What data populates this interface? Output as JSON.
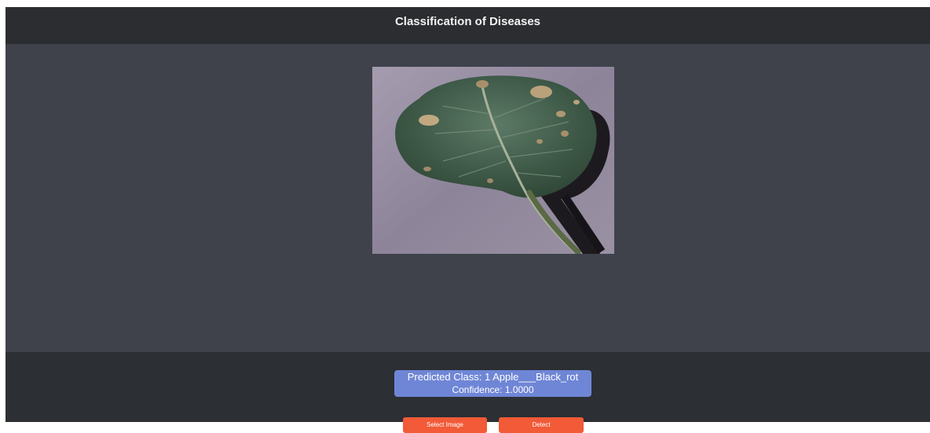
{
  "header": {
    "title": "Classification of Diseases"
  },
  "main": {
    "image_subject": "apple-leaf-icon"
  },
  "result": {
    "predicted_line": "Predicted Class: 1 Apple___Black_rot",
    "confidence_line": "Confidence: 1.0000"
  },
  "actions": {
    "select_label": "Select Image",
    "detect_label": "Detect"
  },
  "colors": {
    "header_bg": "#2b2d31",
    "content_bg": "#3f424b",
    "result_bg": "#6f86d6",
    "button_bg": "#f25a38"
  }
}
